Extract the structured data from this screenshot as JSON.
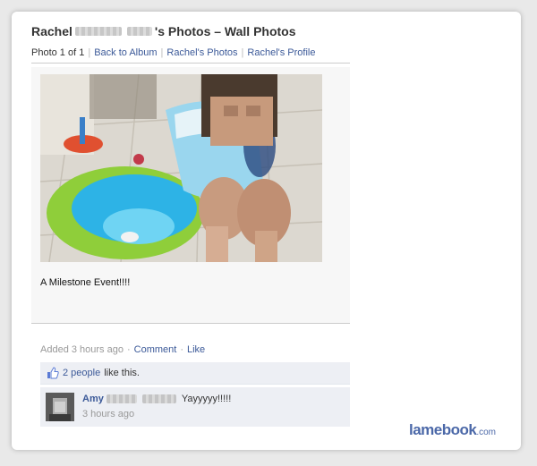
{
  "header": {
    "title_first": "Rachel",
    "title_rest": "'s Photos – Wall Photos"
  },
  "nav": {
    "photo_count": "Photo 1 of 1",
    "back_to_album": "Back to Album",
    "photos_link": "Rachel's Photos",
    "profile_link": "Rachel's Profile"
  },
  "photo": {
    "caption": "A Milestone Event!!!!"
  },
  "meta": {
    "added": "Added 3 hours ago",
    "comment": "Comment",
    "like": "Like"
  },
  "likes": {
    "people": "2 people",
    "suffix": "like this."
  },
  "comment": {
    "author": "Amy",
    "text": "Yayyyyy!!!!!",
    "time": "3 hours ago"
  },
  "brand": {
    "name": "lamebook",
    "suffix": ".com"
  },
  "colors": {
    "link": "#3b5998",
    "like_bg": "#edeff4"
  }
}
